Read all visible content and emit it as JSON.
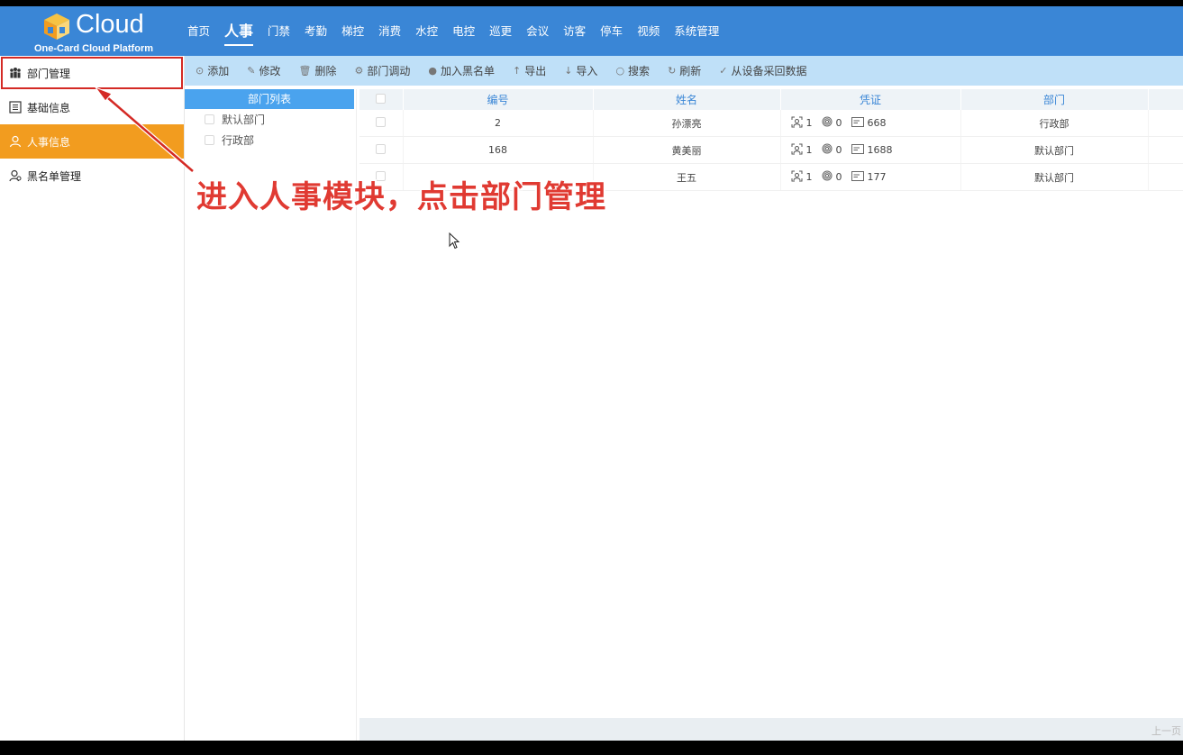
{
  "logo": {
    "word": "Cloud",
    "subtitle": "One-Card Cloud Platform"
  },
  "topnav": {
    "items": [
      {
        "label": "首页"
      },
      {
        "label": "人事",
        "active": true
      },
      {
        "label": "门禁"
      },
      {
        "label": "考勤"
      },
      {
        "label": "梯控"
      },
      {
        "label": "消费"
      },
      {
        "label": "水控"
      },
      {
        "label": "电控"
      },
      {
        "label": "巡更"
      },
      {
        "label": "会议"
      },
      {
        "label": "访客"
      },
      {
        "label": "停车"
      },
      {
        "label": "视频"
      },
      {
        "label": "系统管理"
      }
    ]
  },
  "sidebar": {
    "items": [
      {
        "label": "部门管理",
        "icon": "org-icon"
      },
      {
        "label": "基础信息",
        "icon": "list-icon"
      },
      {
        "label": "人事信息",
        "icon": "person-icon",
        "active": true
      },
      {
        "label": "黑名单管理",
        "icon": "blacklist-person-icon"
      }
    ]
  },
  "toolbar": {
    "buttons": [
      {
        "label": "添加",
        "icon": "⊙"
      },
      {
        "label": "修改",
        "icon": "✎"
      },
      {
        "label": "删除",
        "icon": "🗑"
      },
      {
        "label": "部门调动",
        "icon": "⚙"
      },
      {
        "label": "加入黑名单",
        "icon": "●"
      },
      {
        "label": "导出",
        "icon": "↑"
      },
      {
        "label": "导入",
        "icon": "↓"
      },
      {
        "label": "搜索",
        "icon": "○"
      },
      {
        "label": "刷新",
        "icon": "↻"
      },
      {
        "label": "从设备采回数据",
        "icon": "✓"
      }
    ]
  },
  "dept_panel": {
    "title": "部门列表",
    "items": [
      {
        "label": "默认部门"
      },
      {
        "label": "行政部"
      }
    ]
  },
  "table": {
    "columns": [
      "编号",
      "姓名",
      "凭证",
      "部门"
    ],
    "rows": [
      {
        "id": "2",
        "name": "孙漂亮",
        "face": "1",
        "finger": "0",
        "card": "668",
        "dept": "行政部"
      },
      {
        "id": "168",
        "name": "黄美丽",
        "face": "1",
        "finger": "0",
        "card": "1688",
        "dept": "默认部门"
      },
      {
        "id": "",
        "name": "王五",
        "face": "1",
        "finger": "0",
        "card": "177",
        "dept": "默认部门"
      }
    ]
  },
  "pagination": {
    "prev_label": "上一页"
  },
  "annotation": {
    "text": "进入人事模块，点击部门管理",
    "color": "#e03a32"
  }
}
